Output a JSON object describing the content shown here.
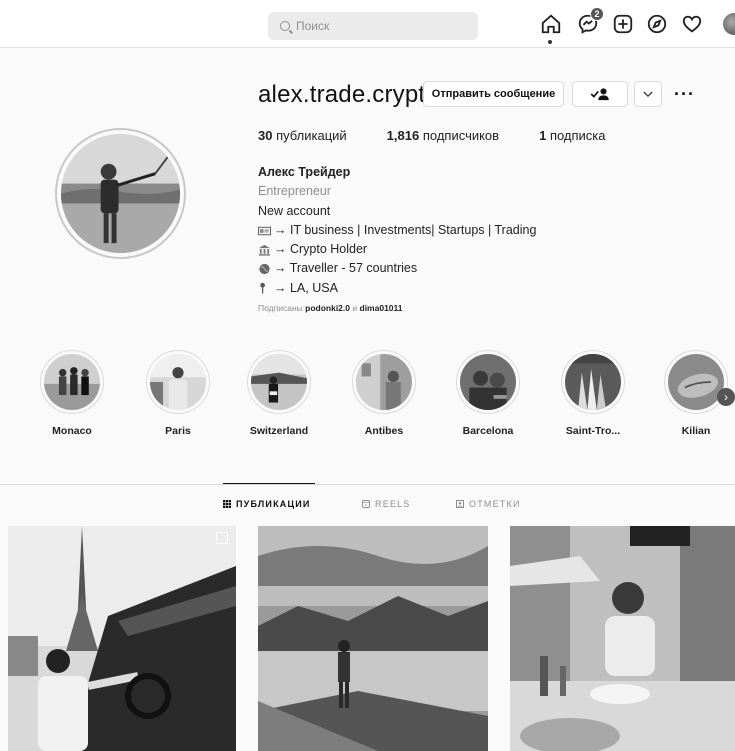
{
  "topbar": {
    "search_placeholder": "Поиск",
    "notification_count": "2",
    "icons": [
      "home-icon",
      "messenger-icon",
      "new-post-icon",
      "explore-icon",
      "activity-heart-icon",
      "profile-avatar"
    ]
  },
  "profile": {
    "username": "alex.trade.crypt",
    "message_button": "Отправить сообщение",
    "more": "···",
    "stats": {
      "posts_count": "30",
      "posts_label": "публикаций",
      "followers_count": "1,816",
      "followers_label": "подписчиков",
      "following_count": "1",
      "following_label": "подписка"
    },
    "bio": {
      "name": "Алекс Трейдер",
      "category": "Entrepreneur",
      "lines": [
        "New account",
        "→ IT business | Investments| Startups | Trading",
        "→ Crypto Holder",
        "→ Traveller - 57 countries",
        "→ LA, USA"
      ]
    },
    "followed_by": {
      "prefix": "Подписаны",
      "user1": "podonki2.0",
      "conj": "и",
      "user2": "dima01011"
    }
  },
  "highlights": [
    {
      "label": "Monaco"
    },
    {
      "label": "Paris"
    },
    {
      "label": "Switzerland"
    },
    {
      "label": "Antibes"
    },
    {
      "label": "Barcelona"
    },
    {
      "label": "Saint-Tro..."
    },
    {
      "label": "Kilian"
    }
  ],
  "tabs": {
    "posts": "ПУБЛИКАЦИИ",
    "reels": "REELS",
    "tagged": "ОТМЕТКИ",
    "active": "posts"
  },
  "colors": {
    "background": "#fafafa",
    "text": "#111111",
    "muted": "#8e8e8e",
    "border": "#dbdbdb"
  }
}
